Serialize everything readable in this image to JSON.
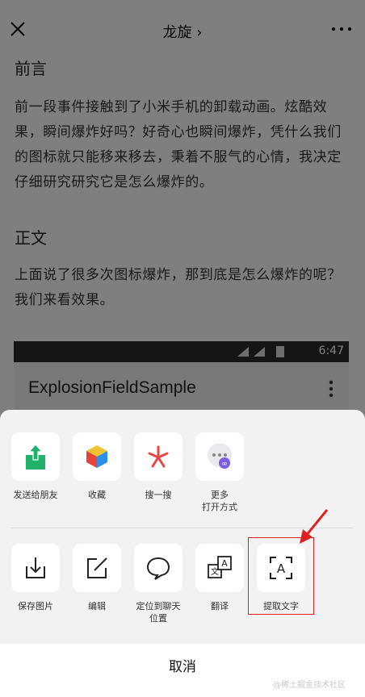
{
  "header": {
    "title": "龙旋"
  },
  "article": {
    "heading1": "前言",
    "para1": "前一段事件接触到了小米手机的卸载动画。炫酷效果，瞬间爆炸好吗？好奇心也瞬间爆炸，凭什么我们的图标就只能移来移去，秉着不服气的心情，我决定仔细研究研究它是怎么爆炸的。",
    "heading2": "正文",
    "para2": "上面说了很多次图标爆炸，那到底是怎么爆炸的呢？我们来看效果。",
    "embedded": {
      "time": "6:47",
      "app_title": "ExplosionFieldSample"
    }
  },
  "share_sheet": {
    "row1": [
      {
        "label": "发送给朋友",
        "icon": "send-to-friend-icon"
      },
      {
        "label": "收藏",
        "icon": "favorite-cube-icon"
      },
      {
        "label": "搜一搜",
        "icon": "search-search-icon"
      },
      {
        "label": "更多\n打开方式",
        "icon": "more-open-with-icon"
      }
    ],
    "row2": [
      {
        "label": "保存图片",
        "icon": "save-image-icon"
      },
      {
        "label": "编辑",
        "icon": "edit-icon"
      },
      {
        "label": "定位到聊天\n位置",
        "icon": "locate-chat-icon"
      },
      {
        "label": "翻译",
        "icon": "translate-icon"
      },
      {
        "label": "提取文字",
        "icon": "extract-text-icon"
      }
    ],
    "cancel_label": "取消"
  },
  "colors": {
    "accent_green": "#20b26b",
    "highlight_red": "#e02020"
  },
  "watermark": "@稀土掘金技术社区"
}
